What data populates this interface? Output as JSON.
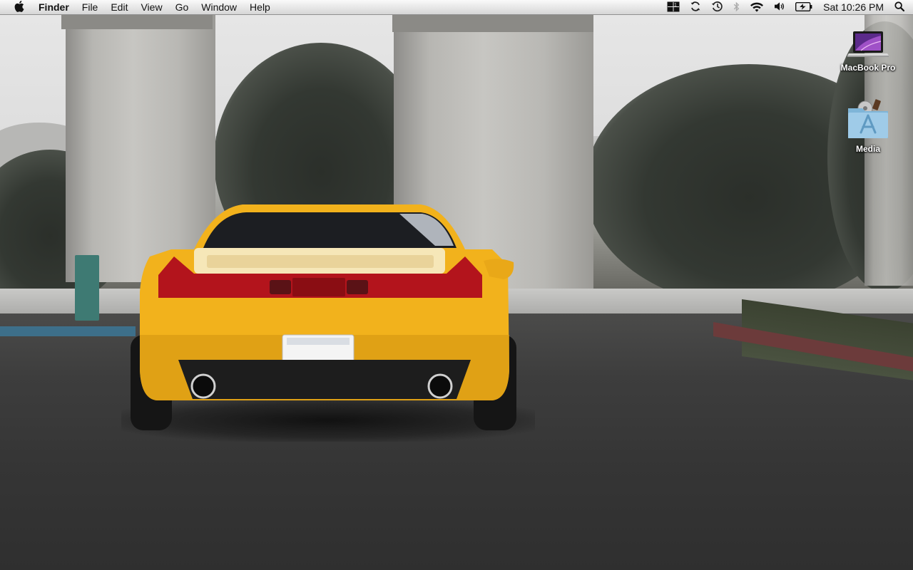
{
  "menubar": {
    "apple_icon": "apple-logo-icon",
    "app_name": "Finder",
    "menus": [
      "File",
      "Edit",
      "View",
      "Go",
      "Window",
      "Help"
    ],
    "status_icons": [
      "spaces-icon",
      "sync-icon",
      "time-machine-icon",
      "bluetooth-icon",
      "wifi-icon",
      "volume-icon",
      "battery-icon"
    ],
    "clock": "Sat 10:26 PM",
    "spotlight_icon": "spotlight-search-icon"
  },
  "desktop": {
    "icons": [
      {
        "label": "MacBook Pro",
        "icon": "laptop-icon"
      },
      {
        "label": "Media",
        "icon": "applications-folder-icon"
      }
    ],
    "colors": {
      "car_body": "#f2b21c",
      "tail_light": "#b3141c",
      "road": "#3a3a39"
    }
  }
}
